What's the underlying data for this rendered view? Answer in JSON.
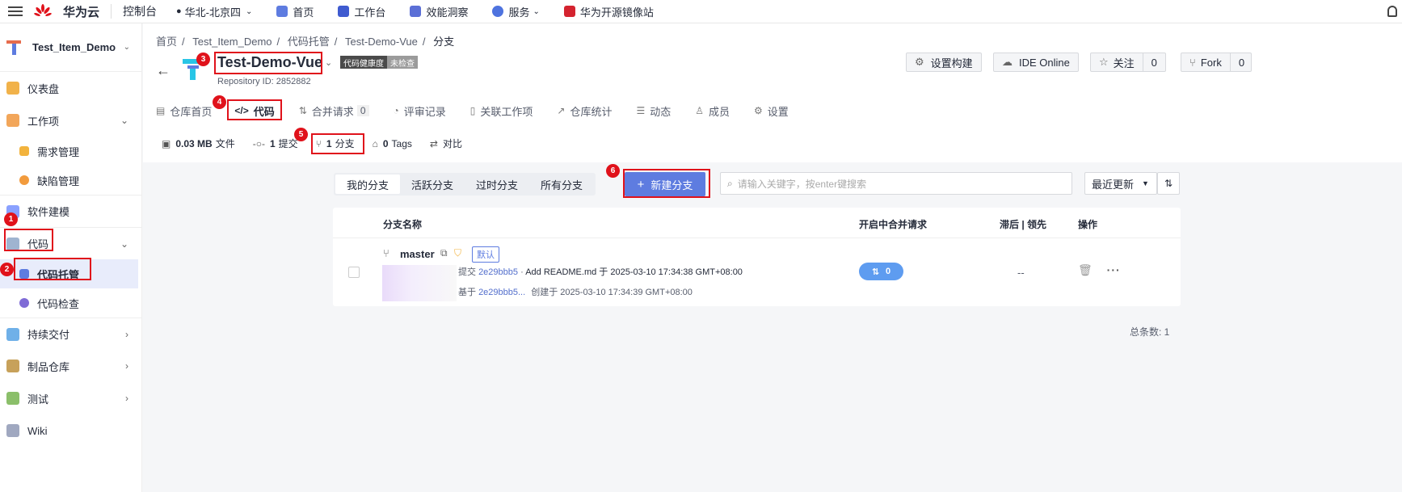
{
  "topbar": {
    "brand": "华为云",
    "console": "控制台",
    "region": "华北-北京四",
    "nav": [
      {
        "label": "首页",
        "color": "#5e7ce0"
      },
      {
        "label": "工作台",
        "color": "#3f5bd0"
      },
      {
        "label": "效能洞察",
        "color": "#5b6fd6"
      },
      {
        "label": "服务",
        "color": "#4e73df"
      },
      {
        "label": "华为开源镜像站",
        "color": "#d4232f"
      }
    ]
  },
  "sidebar": {
    "project": "Test_Item_Demo",
    "items": [
      {
        "label": "仪表盘",
        "color": "#f1b24a"
      },
      {
        "label": "工作项",
        "color": "#f2a65a"
      },
      {
        "label": "需求管理",
        "color": "#f2b33d"
      },
      {
        "label": "缺陷管理",
        "color": "#f29b3d"
      },
      {
        "label": "软件建模",
        "color": "#8aa1ff"
      },
      {
        "label": "代码",
        "color": "#9fb4d0"
      },
      {
        "label": "代码托管",
        "color": "#5e7ce0"
      },
      {
        "label": "代码检查",
        "color": "#7f6bd6"
      },
      {
        "label": "持续交付",
        "color": "#6fb0e8"
      },
      {
        "label": "制品仓库",
        "color": "#c7a15a"
      },
      {
        "label": "测试",
        "color": "#8bbf6a"
      },
      {
        "label": "Wiki",
        "color": "#a0a8c0"
      }
    ]
  },
  "breadcrumb": [
    "首页",
    "Test_Item_Demo",
    "代码托管",
    "Test-Demo-Vue",
    "分支"
  ],
  "repo": {
    "name": "Test-Demo-Vue",
    "id_text": "Repository ID: 2852882",
    "health_label": "代码健康度",
    "health_status": "未检查"
  },
  "actions": {
    "build": "设置构建",
    "ide": "IDE Online",
    "watch": "关注",
    "watch_count": "0",
    "fork": "Fork",
    "fork_count": "0"
  },
  "tabs": [
    "仓库首页",
    "代码",
    "合并请求",
    "0",
    "评审记录",
    "关联工作项",
    "仓库统计",
    "动态",
    "成员",
    "设置"
  ],
  "stats": {
    "size": "0.03 MB",
    "size_label": "文件",
    "commits": "1",
    "commits_label": "提交",
    "branches": "1",
    "branches_label": "分支",
    "tags": "0",
    "tags_label": "Tags",
    "compare": "对比"
  },
  "filters": [
    "我的分支",
    "活跃分支",
    "过时分支",
    "所有分支"
  ],
  "new_branch": "新建分支",
  "search_placeholder": "请输入关键字，按enter键搜索",
  "sort": "最近更新",
  "table": {
    "headers": [
      "分支名称",
      "开启中合并请求",
      "滞后 | 领先",
      "操作"
    ],
    "row": {
      "name": "master",
      "default_label": "默认",
      "commit_prefix": "提交",
      "commit_hash": "2e29bbb5",
      "commit_msg": "Add README.md 于 2025-03-10 17:34:38 GMT+08:00",
      "base_prefix": "基于",
      "base_hash": "2e29bbb5...",
      "created": "创建于 2025-03-10 17:34:39 GMT+08:00",
      "pr_count": "0",
      "behind_ahead": "--"
    }
  },
  "total": "总条数: 1",
  "annotations": [
    "1",
    "2",
    "3",
    "4",
    "5",
    "6"
  ]
}
